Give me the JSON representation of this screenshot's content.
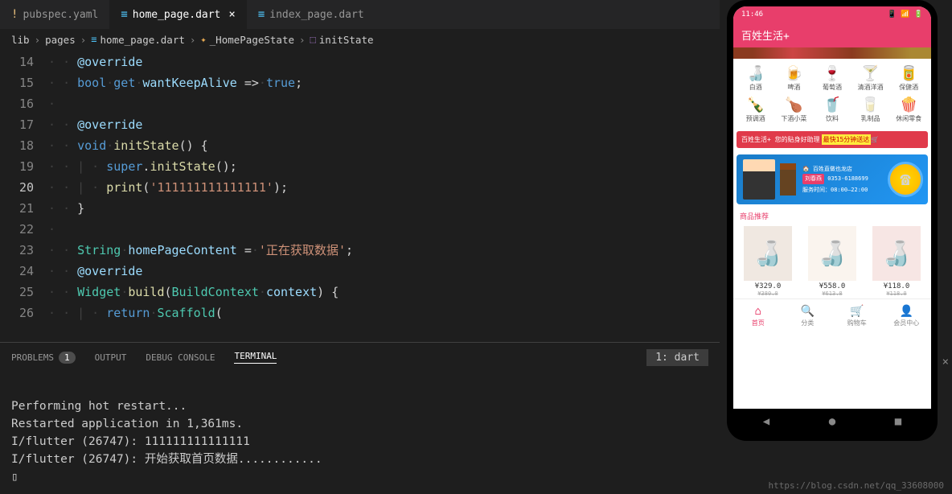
{
  "tabs": [
    {
      "icon": "!",
      "label": "pubspec.yaml",
      "active": false
    },
    {
      "icon": "≡",
      "label": "home_page.dart",
      "active": true,
      "closable": true
    },
    {
      "icon": "≡",
      "label": "index_page.dart",
      "active": false
    }
  ],
  "breadcrumbs": {
    "items": [
      "lib",
      "pages",
      "home_page.dart",
      "_HomePageState",
      "initState"
    ]
  },
  "code": {
    "lines": [
      14,
      15,
      16,
      17,
      18,
      19,
      20,
      21,
      22,
      23,
      24,
      25,
      26
    ],
    "currentLine": 20,
    "l14_override": "@override",
    "l15_bool": "bool",
    "l15_get": "get",
    "l15_prop": "wantKeepAlive",
    "l15_arrow": "=>",
    "l15_true": "true",
    "l17_override": "@override",
    "l18_void": "void",
    "l18_method": "initState",
    "l19_super": "super",
    "l19_method": "initState",
    "l20_print": "print",
    "l20_string": "'111111111111111'",
    "l23_type": "String",
    "l23_var": "homePageContent",
    "l23_string": "'正在获取数据'",
    "l24_override": "@override",
    "l25_type": "Widget",
    "l25_method": "build",
    "l25_param_type": "BuildContext",
    "l25_param": "context",
    "l26_return": "return",
    "l26_scaffold": "Scaffold"
  },
  "panel": {
    "problems": "PROBLEMS",
    "problemsBadge": "1",
    "output": "OUTPUT",
    "debug": "DEBUG CONSOLE",
    "terminal": "TERMINAL",
    "dropdown": "1: dart"
  },
  "terminal": {
    "line1": "Performing hot restart...",
    "line2": "Restarted application in 1,361ms.",
    "line3": "I/flutter (26747): 111111111111111",
    "line4": "I/flutter (26747): 开始获取首页数据............",
    "line5": "▯"
  },
  "phone": {
    "statusTime": "11:46",
    "appTitle": "百姓生活+",
    "categories": [
      {
        "icon": "🍶",
        "label": "白酒"
      },
      {
        "icon": "🍺",
        "label": "啤酒"
      },
      {
        "icon": "🍷",
        "label": "葡萄酒"
      },
      {
        "icon": "🍸",
        "label": "清酒洋酒"
      },
      {
        "icon": "🥫",
        "label": "保健酒"
      },
      {
        "icon": "🍾",
        "label": "预调酒"
      },
      {
        "icon": "🍗",
        "label": "下酒小菜"
      },
      {
        "icon": "🥤",
        "label": "饮料"
      },
      {
        "icon": "🥛",
        "label": "乳制品"
      },
      {
        "icon": "🍿",
        "label": "休闲零食"
      }
    ],
    "promoText": "百姓生活+ 您的贴身好助理",
    "promoHighlight": "最快15分钟送达",
    "infoStore": "🏠 百姓直做也龙店",
    "infoName": "刘春燕",
    "infoPhone": "0353-6188699",
    "infoHours": "服务时间：08:00—22:00",
    "sectionTitle": "商品推荐",
    "products": [
      {
        "price": "¥329.0",
        "old": "¥380.0",
        "bg": "#8b4513"
      },
      {
        "price": "¥558.0",
        "old": "¥613.8",
        "bg": "#d4a574"
      },
      {
        "price": "¥118.0",
        "old": "¥118.0",
        "bg": "#c0392b"
      }
    ],
    "nav": [
      {
        "icon": "⌂",
        "label": "首页",
        "active": true
      },
      {
        "icon": "🔍",
        "label": "分类"
      },
      {
        "icon": "🛒",
        "label": "购物车"
      },
      {
        "icon": "👤",
        "label": "会员中心"
      }
    ]
  },
  "watermark": "https://blog.csdn.net/qq_33608000"
}
